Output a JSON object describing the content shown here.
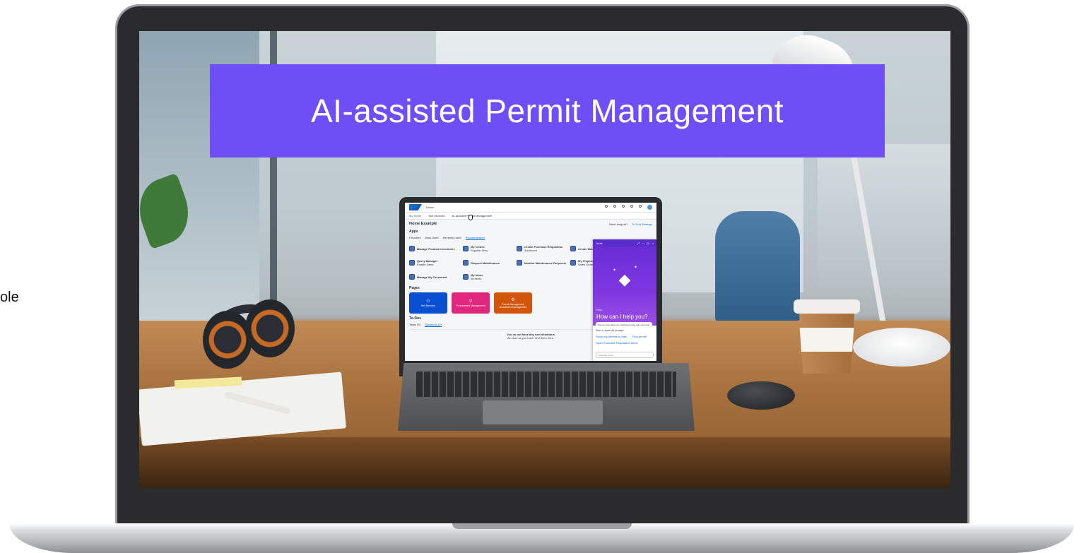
{
  "side_text": "ole",
  "banner": {
    "title": "AI-assisted Permit Management"
  },
  "app": {
    "shell": {
      "home_label": "Home",
      "icons": [
        "search-icon",
        "help-icon",
        "notifications-icon",
        "settings-icon",
        "joule-icon",
        "avatar"
      ]
    },
    "nav": {
      "tabs": [
        "My Home",
        "Self Services",
        "AI-assisted Permit Management"
      ]
    },
    "space": {
      "title": "Home Example",
      "action_1": "Need support?",
      "action_2": "To Do's Settings"
    },
    "apps_section": {
      "title": "Apps",
      "chips": [
        "Favorites",
        "Most Used",
        "Recently Used",
        "Recommended"
      ],
      "tiles": [
        {
          "title": "Manage Product Inventories",
          "sub": ""
        },
        {
          "title": "My Orders",
          "sub": "Supplier View"
        },
        {
          "title": "Create Purchase Requisition",
          "sub": "Advanced"
        },
        {
          "title": "Create Maintenance Request",
          "sub": ""
        },
        {
          "title": "Query Manager",
          "sub": "Enable Sales"
        },
        {
          "title": "Request Maintenance",
          "sub": ""
        },
        {
          "title": "Monitor Maintenance Requests",
          "sub": ""
        },
        {
          "title": "My Shipments",
          "sub": "Sales Order"
        },
        {
          "title": "Manage My Timesheet",
          "sub": ""
        },
        {
          "title": "My Inbox",
          "sub": "All Items"
        }
      ]
    },
    "pages_section": {
      "title": "Pages",
      "cards": [
        {
          "title": "Self Services",
          "color": "#0a4fd1"
        },
        {
          "title": "Procurement Management",
          "color": "#e0267d"
        },
        {
          "title": "Permit Management",
          "sub": "AI-assisted Management",
          "color": "#d1560c"
        }
      ]
    },
    "todo_section": {
      "title": "To-Dos",
      "tabs": [
        "Tasks (0)",
        "Situations (0)"
      ],
      "empty_title": "You do not have any new situations",
      "empty_sub": "As soon as you have, find them here."
    },
    "joule": {
      "title": "Joule",
      "hello": "Hello,",
      "heading": "How can I help you?",
      "prompt": "Tell me more about my expiring permits, with upcoming",
      "suggestions": [
        "Run a Joule AI prompt",
        "Show my permits to date",
        "Find permit",
        "Open Purchase Requisition Items"
      ],
      "input_placeholder": "Message Joule..."
    }
  }
}
